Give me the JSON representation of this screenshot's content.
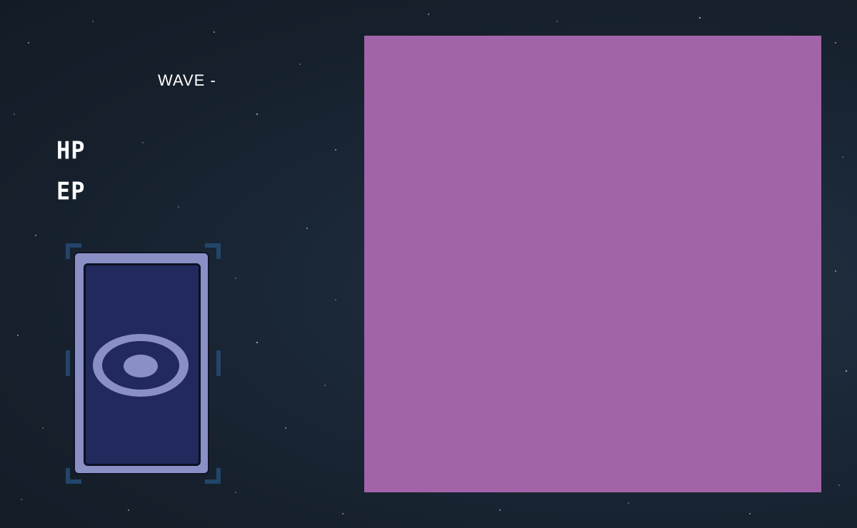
{
  "hud": {
    "wave_label": "WAVE -",
    "hp_label": "HP",
    "ep_label": "EP"
  },
  "card": {
    "icon": "eye-ring-icon",
    "colors": {
      "frame": "#8a8fc6",
      "face": "#22295c",
      "slot_corners": "#23456a"
    }
  },
  "board": {
    "color": "#a264a8"
  },
  "colors": {
    "background": "#17212d",
    "text": "#ffffff"
  }
}
